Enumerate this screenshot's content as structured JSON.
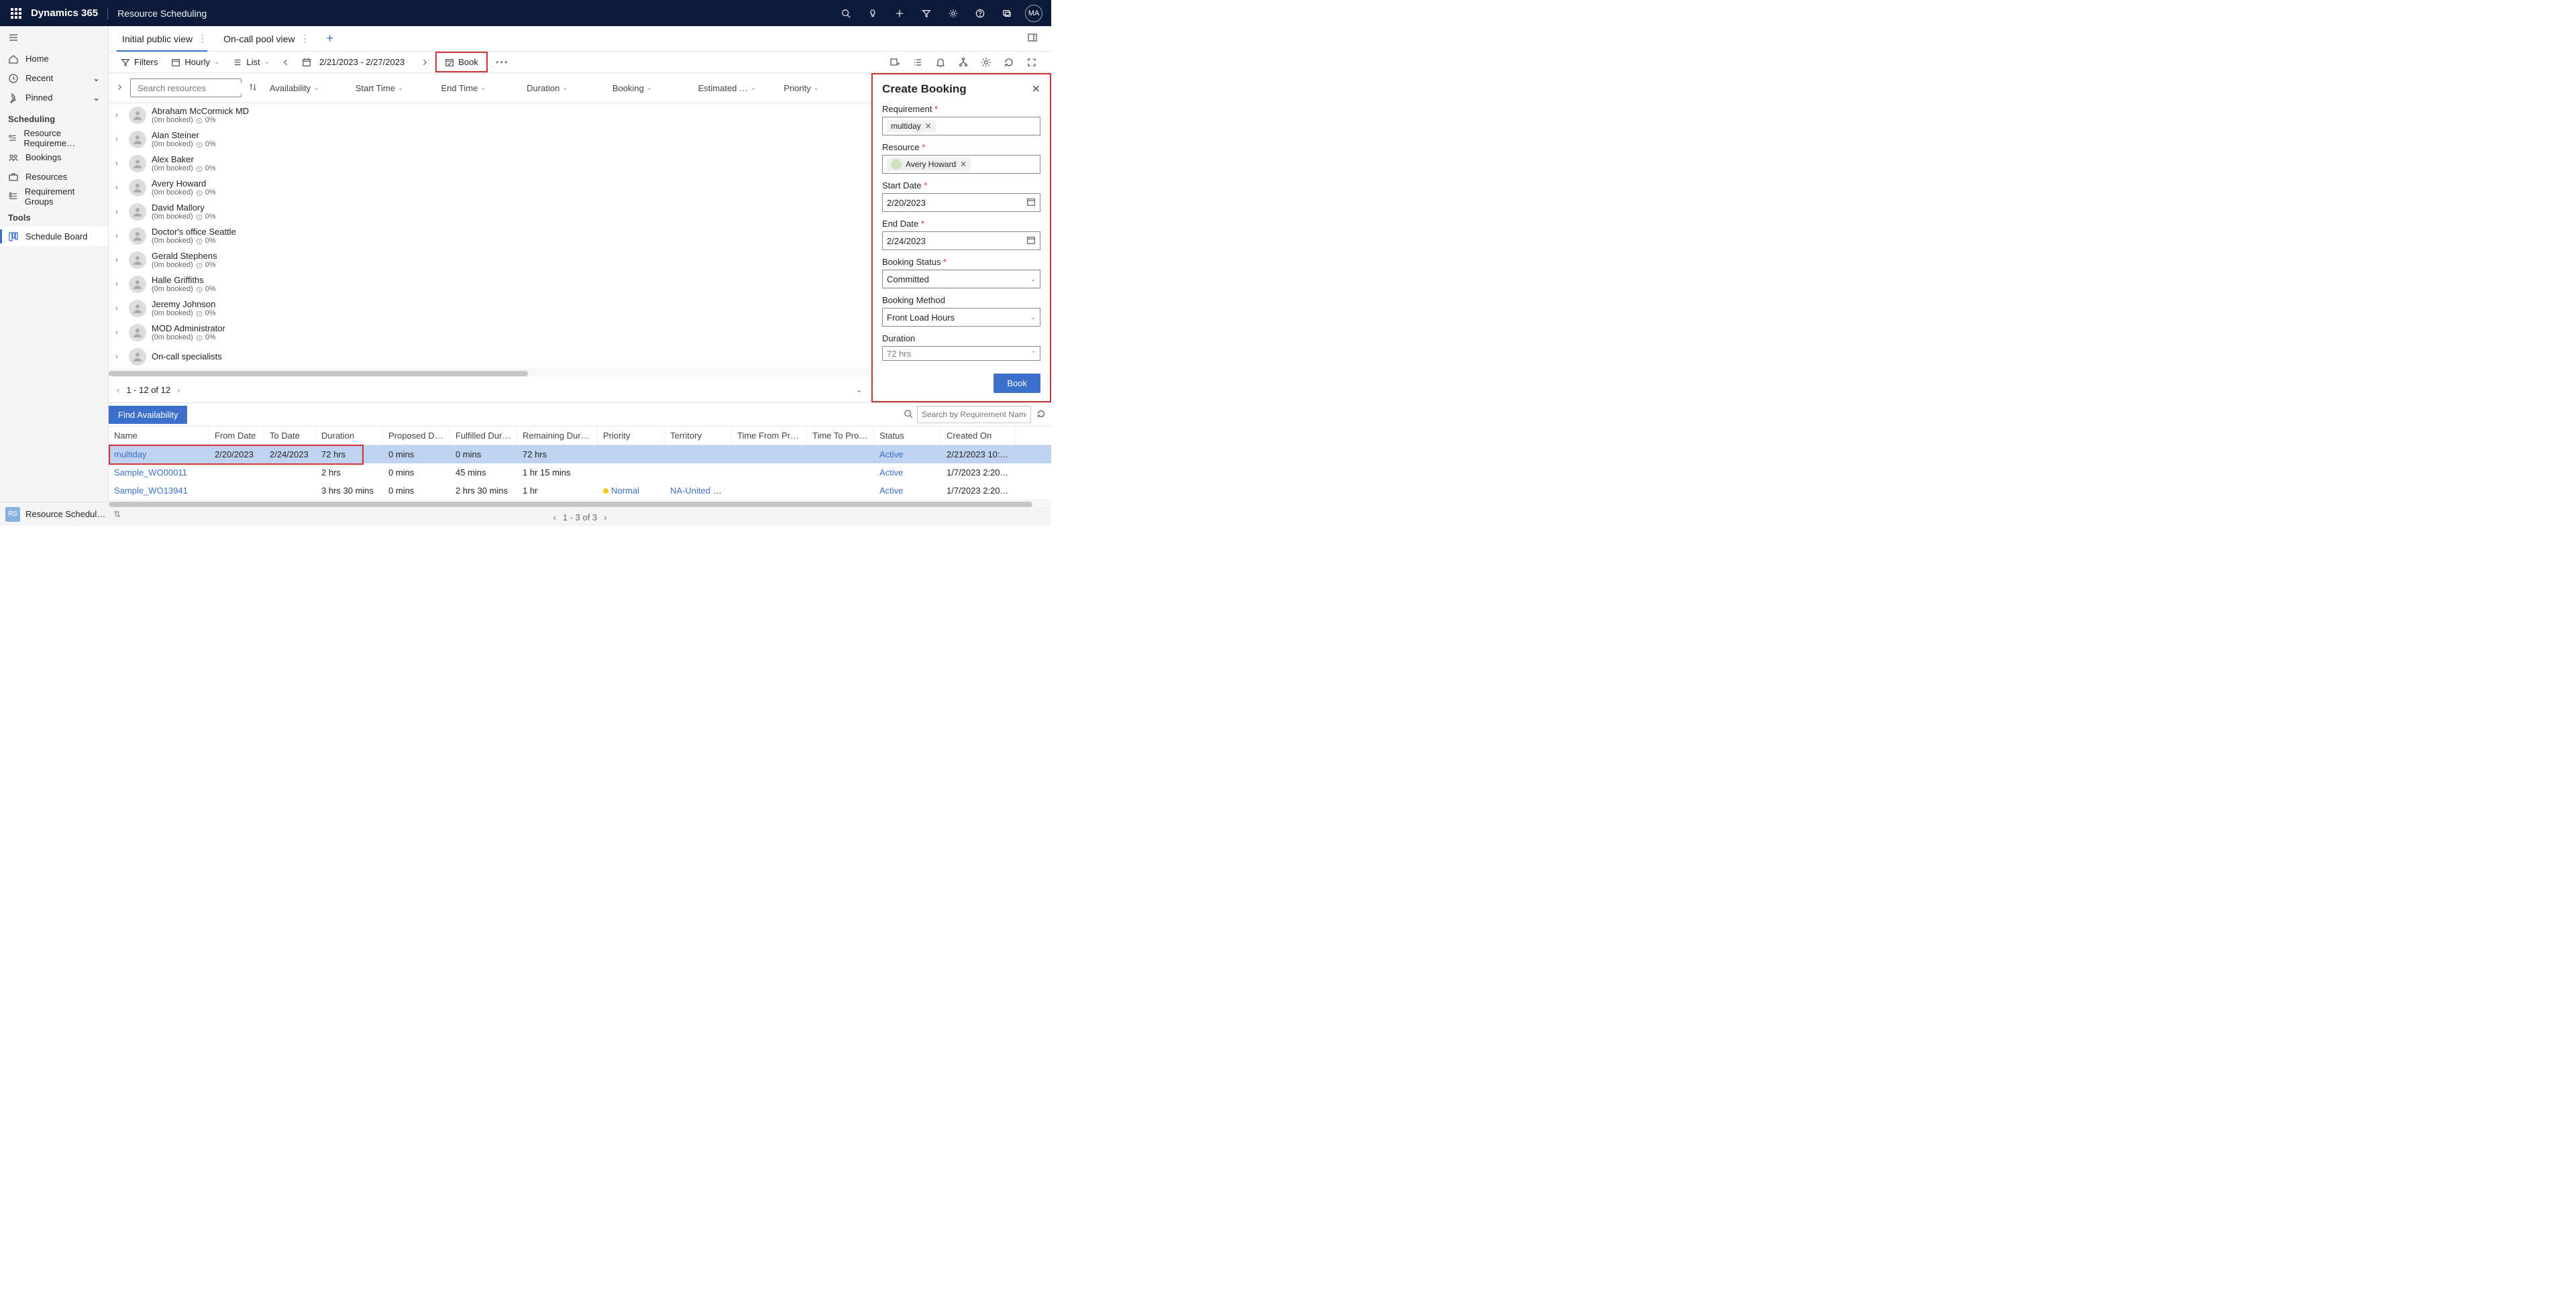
{
  "topbar": {
    "brand": "Dynamics 365",
    "area": "Resource Scheduling",
    "avatar": "MA"
  },
  "leftnav": {
    "home": "Home",
    "recent": "Recent",
    "pinned": "Pinned",
    "section_scheduling": "Scheduling",
    "resreq": "Resource Requireme…",
    "bookings": "Bookings",
    "resources": "Resources",
    "reqgroups": "Requirement Groups",
    "section_tools": "Tools",
    "schedboard": "Schedule Board"
  },
  "tabs": {
    "t1": "Initial public view",
    "t2": "On-call pool view"
  },
  "toolbar": {
    "filters": "Filters",
    "hourly": "Hourly",
    "list": "List",
    "daterange": "2/21/2023 - 2/27/2023",
    "book": "Book"
  },
  "reshdr": {
    "search_ph": "Search resources",
    "c1": "Availability",
    "c2": "Start Time",
    "c3": "End Time",
    "c4": "Duration",
    "c5": "Booking",
    "c6": "Estimated …",
    "c7": "Priority"
  },
  "resources": [
    {
      "name": "Abraham McCormick MD",
      "sub": "(0m booked)",
      "pct": "0%"
    },
    {
      "name": "Alan Steiner",
      "sub": "(0m booked)",
      "pct": "0%"
    },
    {
      "name": "Alex Baker",
      "sub": "(0m booked)",
      "pct": "0%"
    },
    {
      "name": "Avery Howard",
      "sub": "(0m booked)",
      "pct": "0%"
    },
    {
      "name": "David Mallory",
      "sub": "(0m booked)",
      "pct": "0%"
    },
    {
      "name": "Doctor's office Seattle",
      "sub": "(0m booked)",
      "pct": "0%"
    },
    {
      "name": "Gerald Stephens",
      "sub": "(0m booked)",
      "pct": "0%"
    },
    {
      "name": "Halle Griffiths",
      "sub": "(0m booked)",
      "pct": "0%"
    },
    {
      "name": "Jeremy Johnson",
      "sub": "(0m booked)",
      "pct": "0%"
    },
    {
      "name": "MOD Administrator",
      "sub": "(0m booked)",
      "pct": "0%"
    },
    {
      "name": "On-call specialists",
      "sub": ""
    }
  ],
  "pager": {
    "text": "1 - 12 of 12"
  },
  "panel": {
    "title": "Create Booking",
    "lbl_req": "Requirement",
    "val_req": "multiday",
    "lbl_res": "Resource",
    "val_res": "Avery Howard",
    "lbl_start": "Start Date",
    "val_start": "2/20/2023",
    "lbl_end": "End Date",
    "val_end": "2/24/2023",
    "lbl_status": "Booking Status",
    "val_status": "Committed",
    "lbl_method": "Booking Method",
    "val_method": "Front Load Hours",
    "lbl_dur": "Duration",
    "val_dur": "72 hrs",
    "book_btn": "Book"
  },
  "reqgrid": {
    "find": "Find Availability",
    "search_ph": "Search by Requirement Name",
    "cols": {
      "name": "Name",
      "from": "From Date",
      "to": "To Date",
      "dur": "Duration",
      "prop": "Proposed Dur…",
      "fulf": "Fulfilled Durat…",
      "rem": "Remaining Duration",
      "pri": "Priority",
      "terr": "Territory",
      "tfp": "Time From Promis…",
      "ttp": "Time To Promised",
      "status": "Status",
      "created": "Created On"
    },
    "rows": [
      {
        "name": "multiday",
        "from": "2/20/2023",
        "to": "2/24/2023",
        "dur": "72 hrs",
        "prop": "0 mins",
        "fulf": "0 mins",
        "rem": "72 hrs",
        "pri": "",
        "terr": "",
        "tfp": "",
        "ttp": "",
        "status": "Active",
        "created": "2/21/2023 10:01 A…"
      },
      {
        "name": "Sample_WO00011",
        "from": "",
        "to": "",
        "dur": "2 hrs",
        "prop": "0 mins",
        "fulf": "45 mins",
        "rem": "1 hr 15 mins",
        "pri": "",
        "terr": "",
        "tfp": "",
        "ttp": "",
        "status": "Active",
        "created": "1/7/2023 2:20 PM"
      },
      {
        "name": "Sample_WO13941",
        "from": "",
        "to": "",
        "dur": "3 hrs 30 mins",
        "prop": "0 mins",
        "fulf": "2 hrs 30 mins",
        "rem": "1 hr",
        "pri": "Normal",
        "terr": "NA-United Sta…",
        "tfp": "",
        "ttp": "",
        "status": "Active",
        "created": "1/7/2023 2:20 PM"
      }
    ],
    "pager": "1 - 3 of 3"
  },
  "statusbar": {
    "tile": "RS",
    "area": "Resource Schedul…"
  }
}
